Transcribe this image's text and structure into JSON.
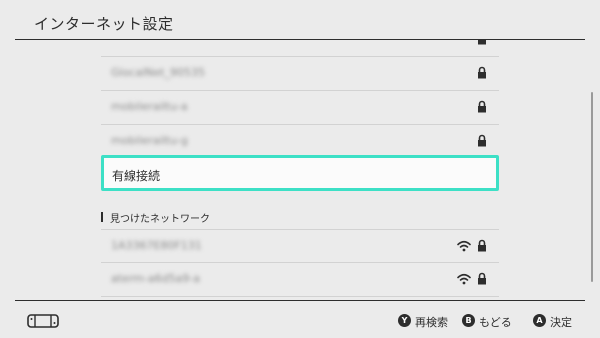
{
  "header": {
    "title": "インターネット設定"
  },
  "networks": [
    {
      "label": "　　　　　　　　",
      "locked": true,
      "blurred": true
    },
    {
      "label": "GlocalNet_90535",
      "locked": true,
      "blurred": true
    },
    {
      "label": "mobilerailtu-a",
      "locked": true,
      "blurred": true
    },
    {
      "label": "mobilerailtu-g",
      "locked": true,
      "blurred": true
    }
  ],
  "selected": {
    "label": "有線接続"
  },
  "section": {
    "title": "見つけたネットワーク"
  },
  "found": [
    {
      "label": "1A3367E80F131",
      "wifi": true,
      "locked": true,
      "blurred": true
    },
    {
      "label": "aterm-a6d5a9-a",
      "wifi": true,
      "locked": true,
      "blurred": true
    }
  ],
  "footer": {
    "hints": [
      {
        "button": "Y",
        "label": "再検索"
      },
      {
        "button": "B",
        "label": "もどる"
      },
      {
        "button": "A",
        "label": "決定"
      }
    ]
  },
  "colors": {
    "accent": "#3de0c6",
    "background": "#ebebeb",
    "text": "#2d2d2d"
  }
}
